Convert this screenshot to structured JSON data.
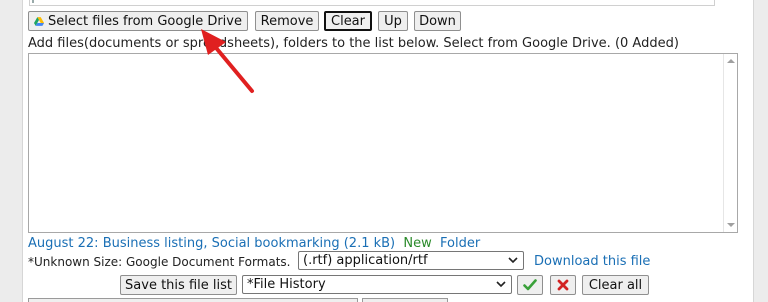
{
  "toolbar": {
    "select_drive_label": "Select files from Google Drive",
    "remove_label": "Remove",
    "clear_label": "Clear",
    "up_label": "Up",
    "down_label": "Down"
  },
  "instructions": "Add files(documents or spreadsheets), folders to the list below. Select from Google Drive. (0 Added)",
  "file_list": {
    "items": []
  },
  "history_entry": {
    "prefix": "August 22:",
    "text": "Business listing, Social bookmarking (2.1 kB)",
    "new_label": "New",
    "folder_label": "Folder"
  },
  "format_row": {
    "note": "*Unknown Size: Google Document Formats.",
    "format_value": "(.rtf) application/rtf",
    "download_label": "Download this file"
  },
  "save_row": {
    "save_label": "Save this file list",
    "history_value": "*File History",
    "clear_all_label": "Clear all"
  },
  "colors": {
    "link": "#1a6fb5",
    "new": "#2a8a2a",
    "confirm": "#3aa13a",
    "delete": "#d22222",
    "annotation_arrow": "#e02020"
  },
  "icons": {
    "drive": "google-drive-icon",
    "confirm": "checkmark-icon",
    "delete": "x-icon",
    "annotation": "red-arrow-annotation"
  }
}
